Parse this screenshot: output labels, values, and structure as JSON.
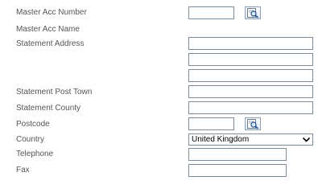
{
  "form": {
    "master_acc_number": {
      "label": "Master Acc Number",
      "value": ""
    },
    "master_acc_name": {
      "label": "Master Acc Name"
    },
    "statement_address": {
      "label": "Statement Address",
      "line1": "",
      "line2": "",
      "line3": ""
    },
    "statement_post_town": {
      "label": "Statement Post Town",
      "value": ""
    },
    "statement_county": {
      "label": "Statement County",
      "value": ""
    },
    "postcode": {
      "label": "Postcode",
      "value": ""
    },
    "country": {
      "label": "Country",
      "selected": "United Kingdom"
    },
    "telephone": {
      "label": "Telephone",
      "value": ""
    },
    "fax": {
      "label": "Fax",
      "value": ""
    }
  },
  "icons": {
    "lookup": "magnifier-over-document-icon",
    "dropdown": "chevron-down-icon"
  },
  "colors": {
    "label_text": "#555555",
    "input_border": "#7f8c99",
    "background": "#ffffff"
  }
}
